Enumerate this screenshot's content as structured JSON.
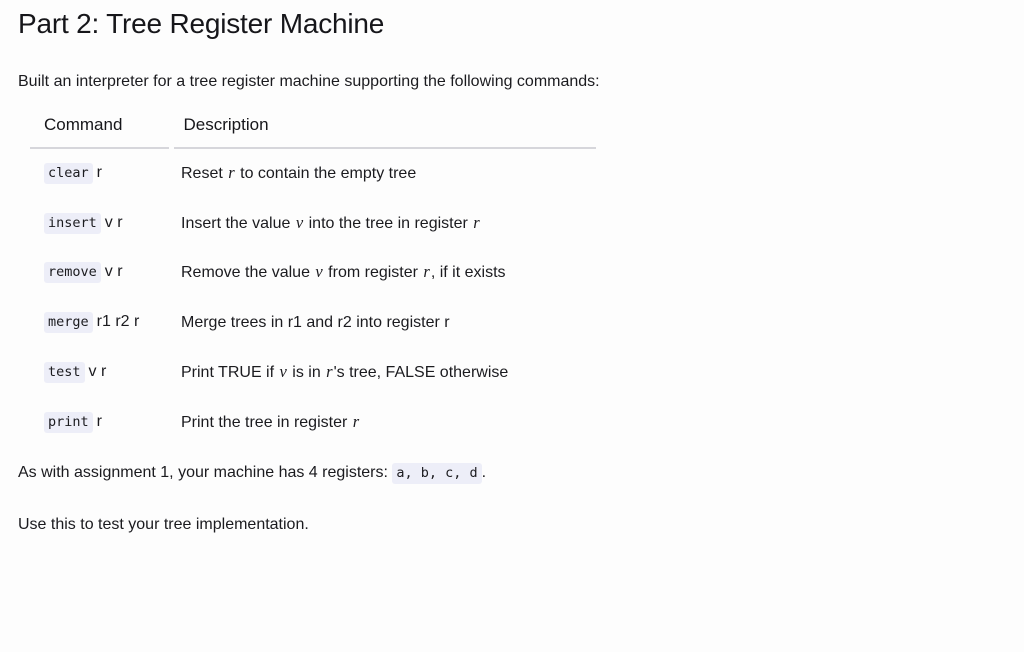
{
  "page": {
    "title": "Part 2: Tree Register Machine",
    "intro": "Built an interpreter for a tree register machine supporting the following commands:"
  },
  "table": {
    "headers": {
      "command": "Command",
      "description": "Description"
    },
    "rows": [
      {
        "code": "clear",
        "args": "r",
        "desc_before": "Reset ",
        "desc_var1": "r",
        "desc_mid": " to contain the empty tree",
        "desc_var2": "",
        "desc_after": ""
      },
      {
        "code": "insert",
        "args": "v r",
        "desc_before": "Insert the value ",
        "desc_var1": "v",
        "desc_mid": " into the tree in register ",
        "desc_var2": "r",
        "desc_after": ""
      },
      {
        "code": "remove",
        "args": "v r",
        "desc_before": "Remove the value ",
        "desc_var1": "v",
        "desc_mid": " from register ",
        "desc_var2": "r",
        "desc_after": ", if it exists"
      },
      {
        "code": "merge",
        "args": "r1 r2 r",
        "desc_before": "Merge trees in r1 and r2 into register r",
        "desc_var1": "",
        "desc_mid": "",
        "desc_var2": "",
        "desc_after": ""
      },
      {
        "code": "test",
        "args": "v r",
        "desc_before": "Print TRUE if ",
        "desc_var1": "v",
        "desc_mid": " is in ",
        "desc_var2": "r",
        "desc_after": "'s tree, FALSE otherwise"
      },
      {
        "code": "print",
        "args": "r",
        "desc_before": "Print the tree in register ",
        "desc_var1": "r",
        "desc_mid": "",
        "desc_var2": "",
        "desc_after": ""
      }
    ]
  },
  "closing": {
    "registers_before": "As with assignment 1, your machine has 4 registers: ",
    "registers_code": "a, b, c, d",
    "registers_after": ".",
    "usage": "Use this to test your tree implementation."
  },
  "colors": {
    "code_chip_background": "#edeef8",
    "text": "#1b1b1f",
    "rule": "#d6d6db",
    "background": "#fdfdfd"
  }
}
